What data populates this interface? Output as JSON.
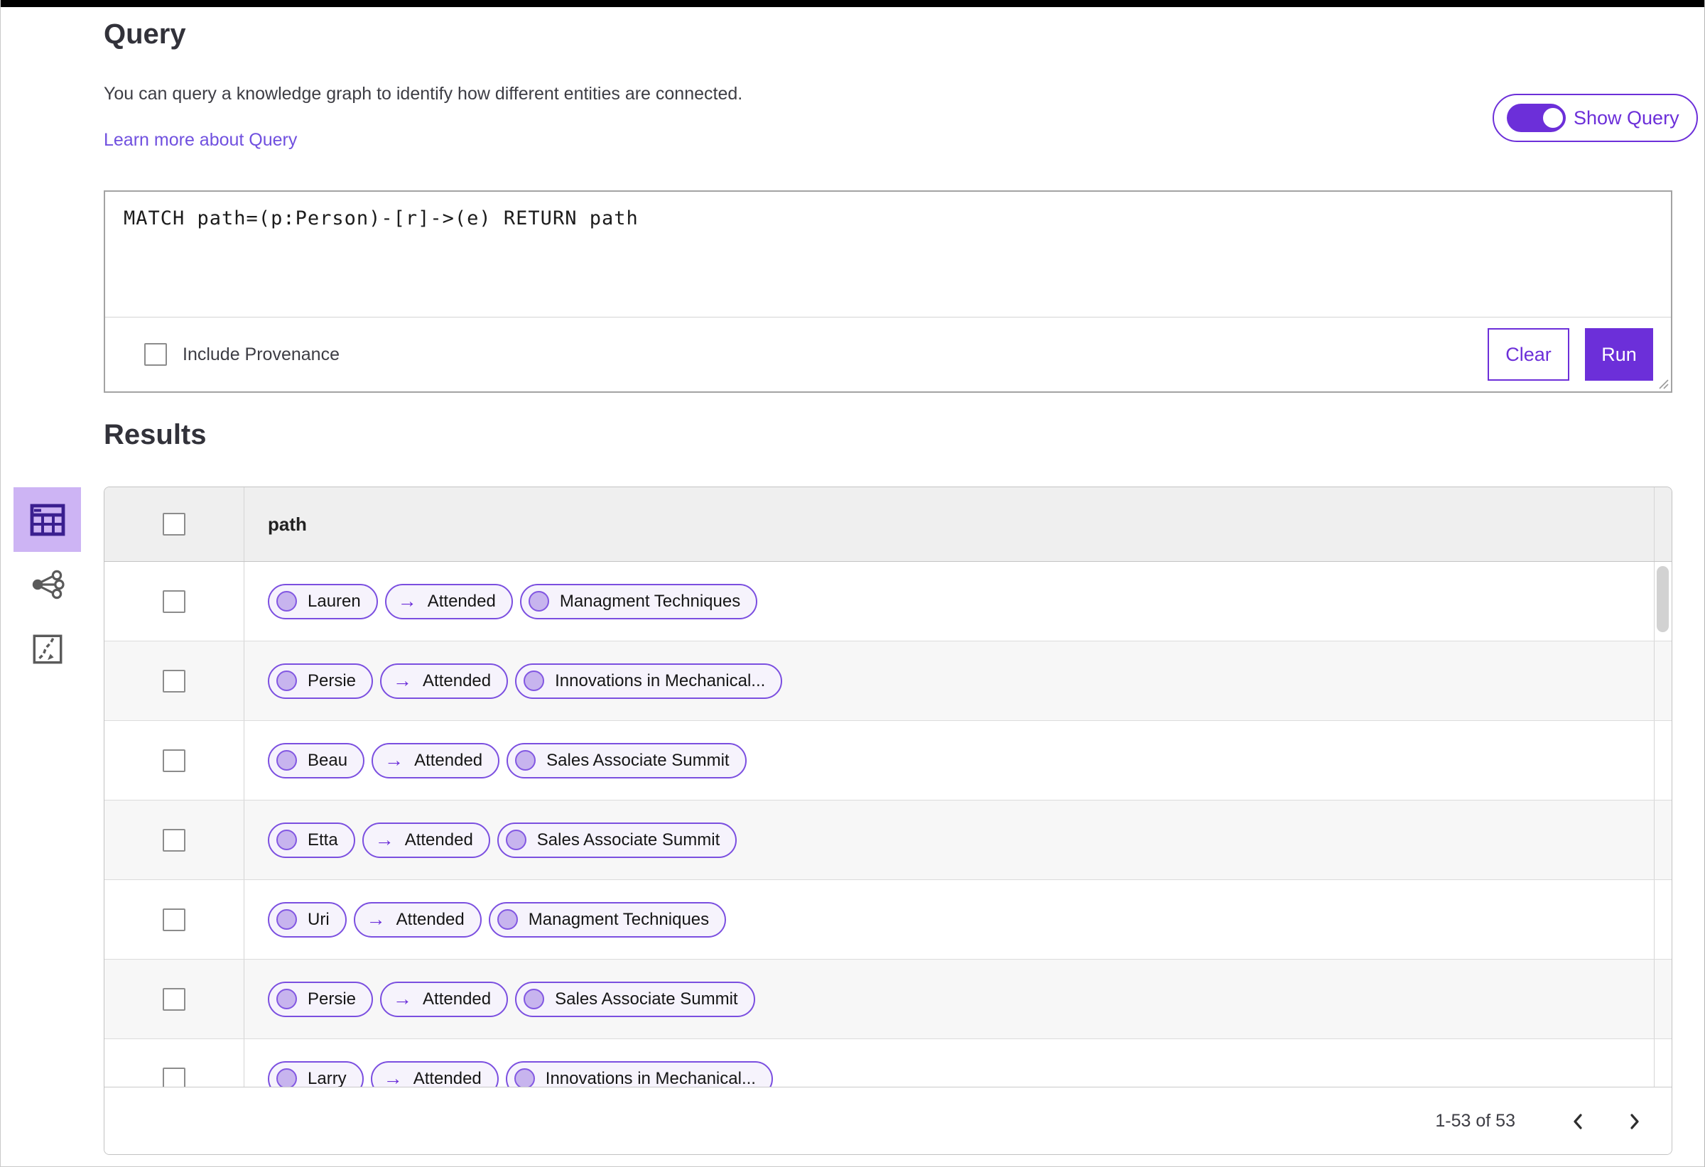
{
  "header": {
    "title": "Query",
    "description": "You can query a knowledge graph to identify how different entities are connected.",
    "learn_more_link": "Learn more about Query",
    "show_query_toggle": {
      "label": "Show Query",
      "state": "on"
    }
  },
  "query_editor": {
    "text": "MATCH path=(p:Person)-[r]->(e) RETURN path",
    "include_provenance": {
      "label": "Include Provenance",
      "checked": false
    },
    "clear_button": "Clear",
    "run_button": "Run"
  },
  "results": {
    "heading": "Results",
    "view_switcher": [
      {
        "icon": "table-view-icon",
        "selected": true
      },
      {
        "icon": "network-view-icon",
        "selected": false
      },
      {
        "icon": "chart-view-icon",
        "selected": false
      }
    ],
    "table": {
      "column_header": "path",
      "rows": [
        {
          "node": "Lauren",
          "edge": "Attended",
          "target": "Managment Techniques"
        },
        {
          "node": "Persie",
          "edge": "Attended",
          "target": "Innovations in Mechanical..."
        },
        {
          "node": "Beau",
          "edge": "Attended",
          "target": "Sales Associate Summit"
        },
        {
          "node": "Etta",
          "edge": "Attended",
          "target": "Sales Associate Summit"
        },
        {
          "node": "Uri",
          "edge": "Attended",
          "target": "Managment Techniques"
        },
        {
          "node": "Persie",
          "edge": "Attended",
          "target": "Sales Associate Summit"
        },
        {
          "node": "Larry",
          "edge": "Attended",
          "target": "Innovations in Mechanical..."
        }
      ]
    },
    "pagination": {
      "range_label": "1-53 of 53"
    }
  },
  "icons": {
    "arrow_right": "→"
  },
  "colors": {
    "accent": "#6C2FD9",
    "pill_border": "#7B4FE0",
    "pill_background": "#F6F3FC",
    "node_fill": "#C7B4EE",
    "selected_view_background": "#CDB4F4",
    "header_row_background": "#EFEFEF",
    "stripe_row_background": "#F7F7F7"
  }
}
